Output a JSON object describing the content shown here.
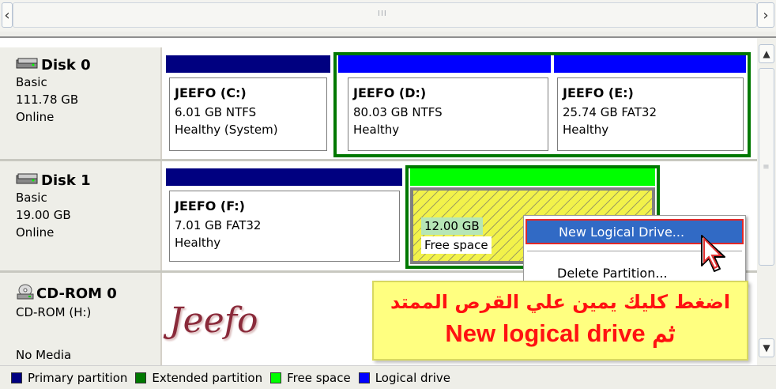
{
  "scrollbar_h": {
    "grip": "III",
    "left_arrow": "‹",
    "right_arrow": "›"
  },
  "disks": [
    {
      "title": "Disk 0",
      "type": "Basic",
      "size": "111.78 GB",
      "status": "Online"
    },
    {
      "title": "Disk 1",
      "type": "Basic",
      "size": "19.00 GB",
      "status": "Online"
    },
    {
      "title": "CD-ROM 0",
      "type": "CD-ROM (H:)",
      "status": "No Media"
    }
  ],
  "partitions": {
    "c": {
      "name": "JEEFO  (C:)",
      "size": "6.01 GB NTFS",
      "status": "Healthy (System)"
    },
    "d": {
      "name": "JEEFO  (D:)",
      "size": "80.03 GB NTFS",
      "status": "Healthy"
    },
    "e": {
      "name": "JEEFO  (E:)",
      "size": "25.74 GB FAT32",
      "status": "Healthy"
    },
    "f": {
      "name": "JEEFO  (F:)",
      "size": "7.01 GB FAT32",
      "status": "Healthy"
    },
    "free": {
      "size": "12.00 GB",
      "status": "Free space"
    }
  },
  "context_menu": {
    "items": [
      "New Logical Drive...",
      "Delete Partition..."
    ]
  },
  "annotation": {
    "line1": "اضغط كليك يمين علي القرص الممتد",
    "line2": "ثم New logical drive"
  },
  "signature": "Jeefo",
  "legend": [
    {
      "label": "Primary partition",
      "color": "#000080"
    },
    {
      "label": "Extended partition",
      "color": "#007800"
    },
    {
      "label": "Free space",
      "color": "#00ff00"
    },
    {
      "label": "Logical drive",
      "color": "#0000ff"
    }
  ],
  "icons": [
    "disk-icon",
    "cd-rom-icon",
    "scroll-left-icon",
    "scroll-right-icon",
    "scroll-up-icon",
    "scroll-down-icon",
    "mouse-pointer-icon"
  ]
}
